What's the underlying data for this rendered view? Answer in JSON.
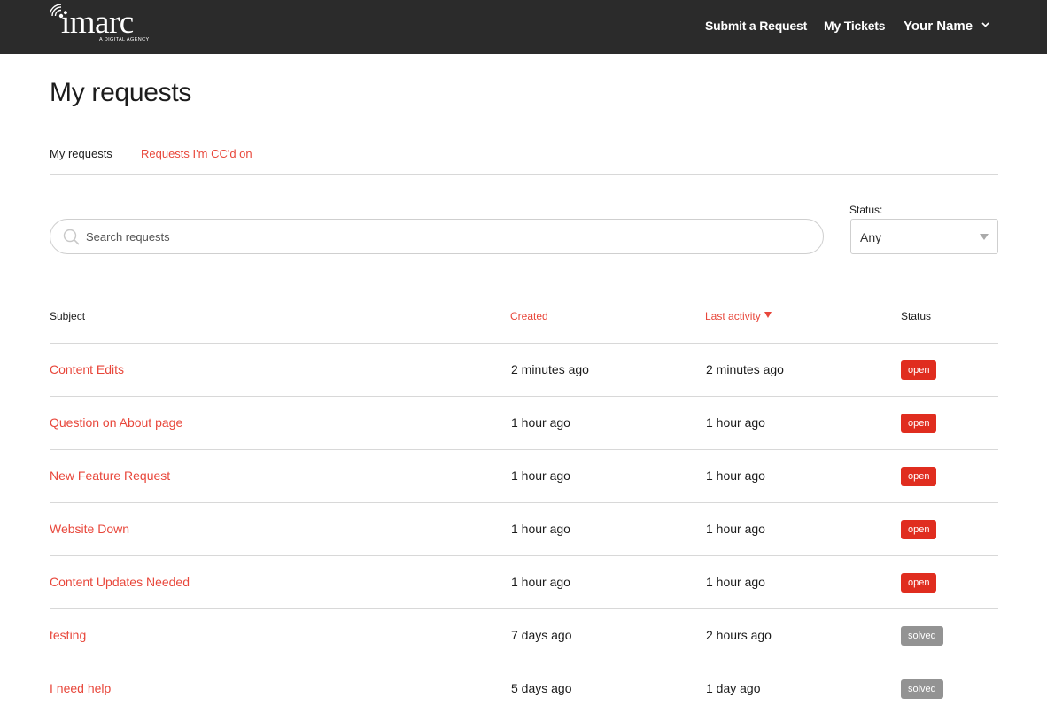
{
  "header": {
    "logo_word": "imarc",
    "logo_tagline": "A DIGITAL AGENCY",
    "nav": {
      "submit_request": "Submit a Request",
      "my_tickets": "My Tickets",
      "user_name": "Your Name"
    }
  },
  "page": {
    "title": "My requests",
    "tabs": [
      {
        "label": "My requests",
        "active": true
      },
      {
        "label": "Requests I'm CC'd on",
        "active": false
      }
    ]
  },
  "search": {
    "placeholder": "Search requests",
    "value": ""
  },
  "status_filter": {
    "label": "Status:",
    "value": "Any"
  },
  "table": {
    "columns": {
      "subject": "Subject",
      "created": "Created",
      "last_activity": "Last activity",
      "status": "Status"
    },
    "sort": {
      "column": "last_activity",
      "direction": "desc"
    },
    "rows": [
      {
        "subject": "Content Edits",
        "created": "2 minutes ago",
        "last_activity": "2 minutes ago",
        "status": "open"
      },
      {
        "subject": "Question on About page",
        "created": "1 hour ago",
        "last_activity": "1 hour ago",
        "status": "open"
      },
      {
        "subject": "New Feature Request",
        "created": "1 hour ago",
        "last_activity": "1 hour ago",
        "status": "open"
      },
      {
        "subject": "Website Down",
        "created": "1 hour ago",
        "last_activity": "1 hour ago",
        "status": "open"
      },
      {
        "subject": "Content Updates Needed",
        "created": "1 hour ago",
        "last_activity": "1 hour ago",
        "status": "open"
      },
      {
        "subject": "testing",
        "created": "7 days ago",
        "last_activity": "2 hours ago",
        "status": "solved"
      },
      {
        "subject": "I need help",
        "created": "5 days ago",
        "last_activity": "1 day ago",
        "status": "solved"
      }
    ]
  },
  "colors": {
    "header_bg": "#2b2b2b",
    "accent": "#e8473b",
    "badge_open": "#e02d1f",
    "badge_solved": "#939393"
  },
  "icons": {
    "logo": "signal-arc-logo-icon",
    "user_menu": "chevron-down-icon",
    "search": "search-icon",
    "select": "caret-down-icon",
    "sort": "sort-descending-icon"
  }
}
